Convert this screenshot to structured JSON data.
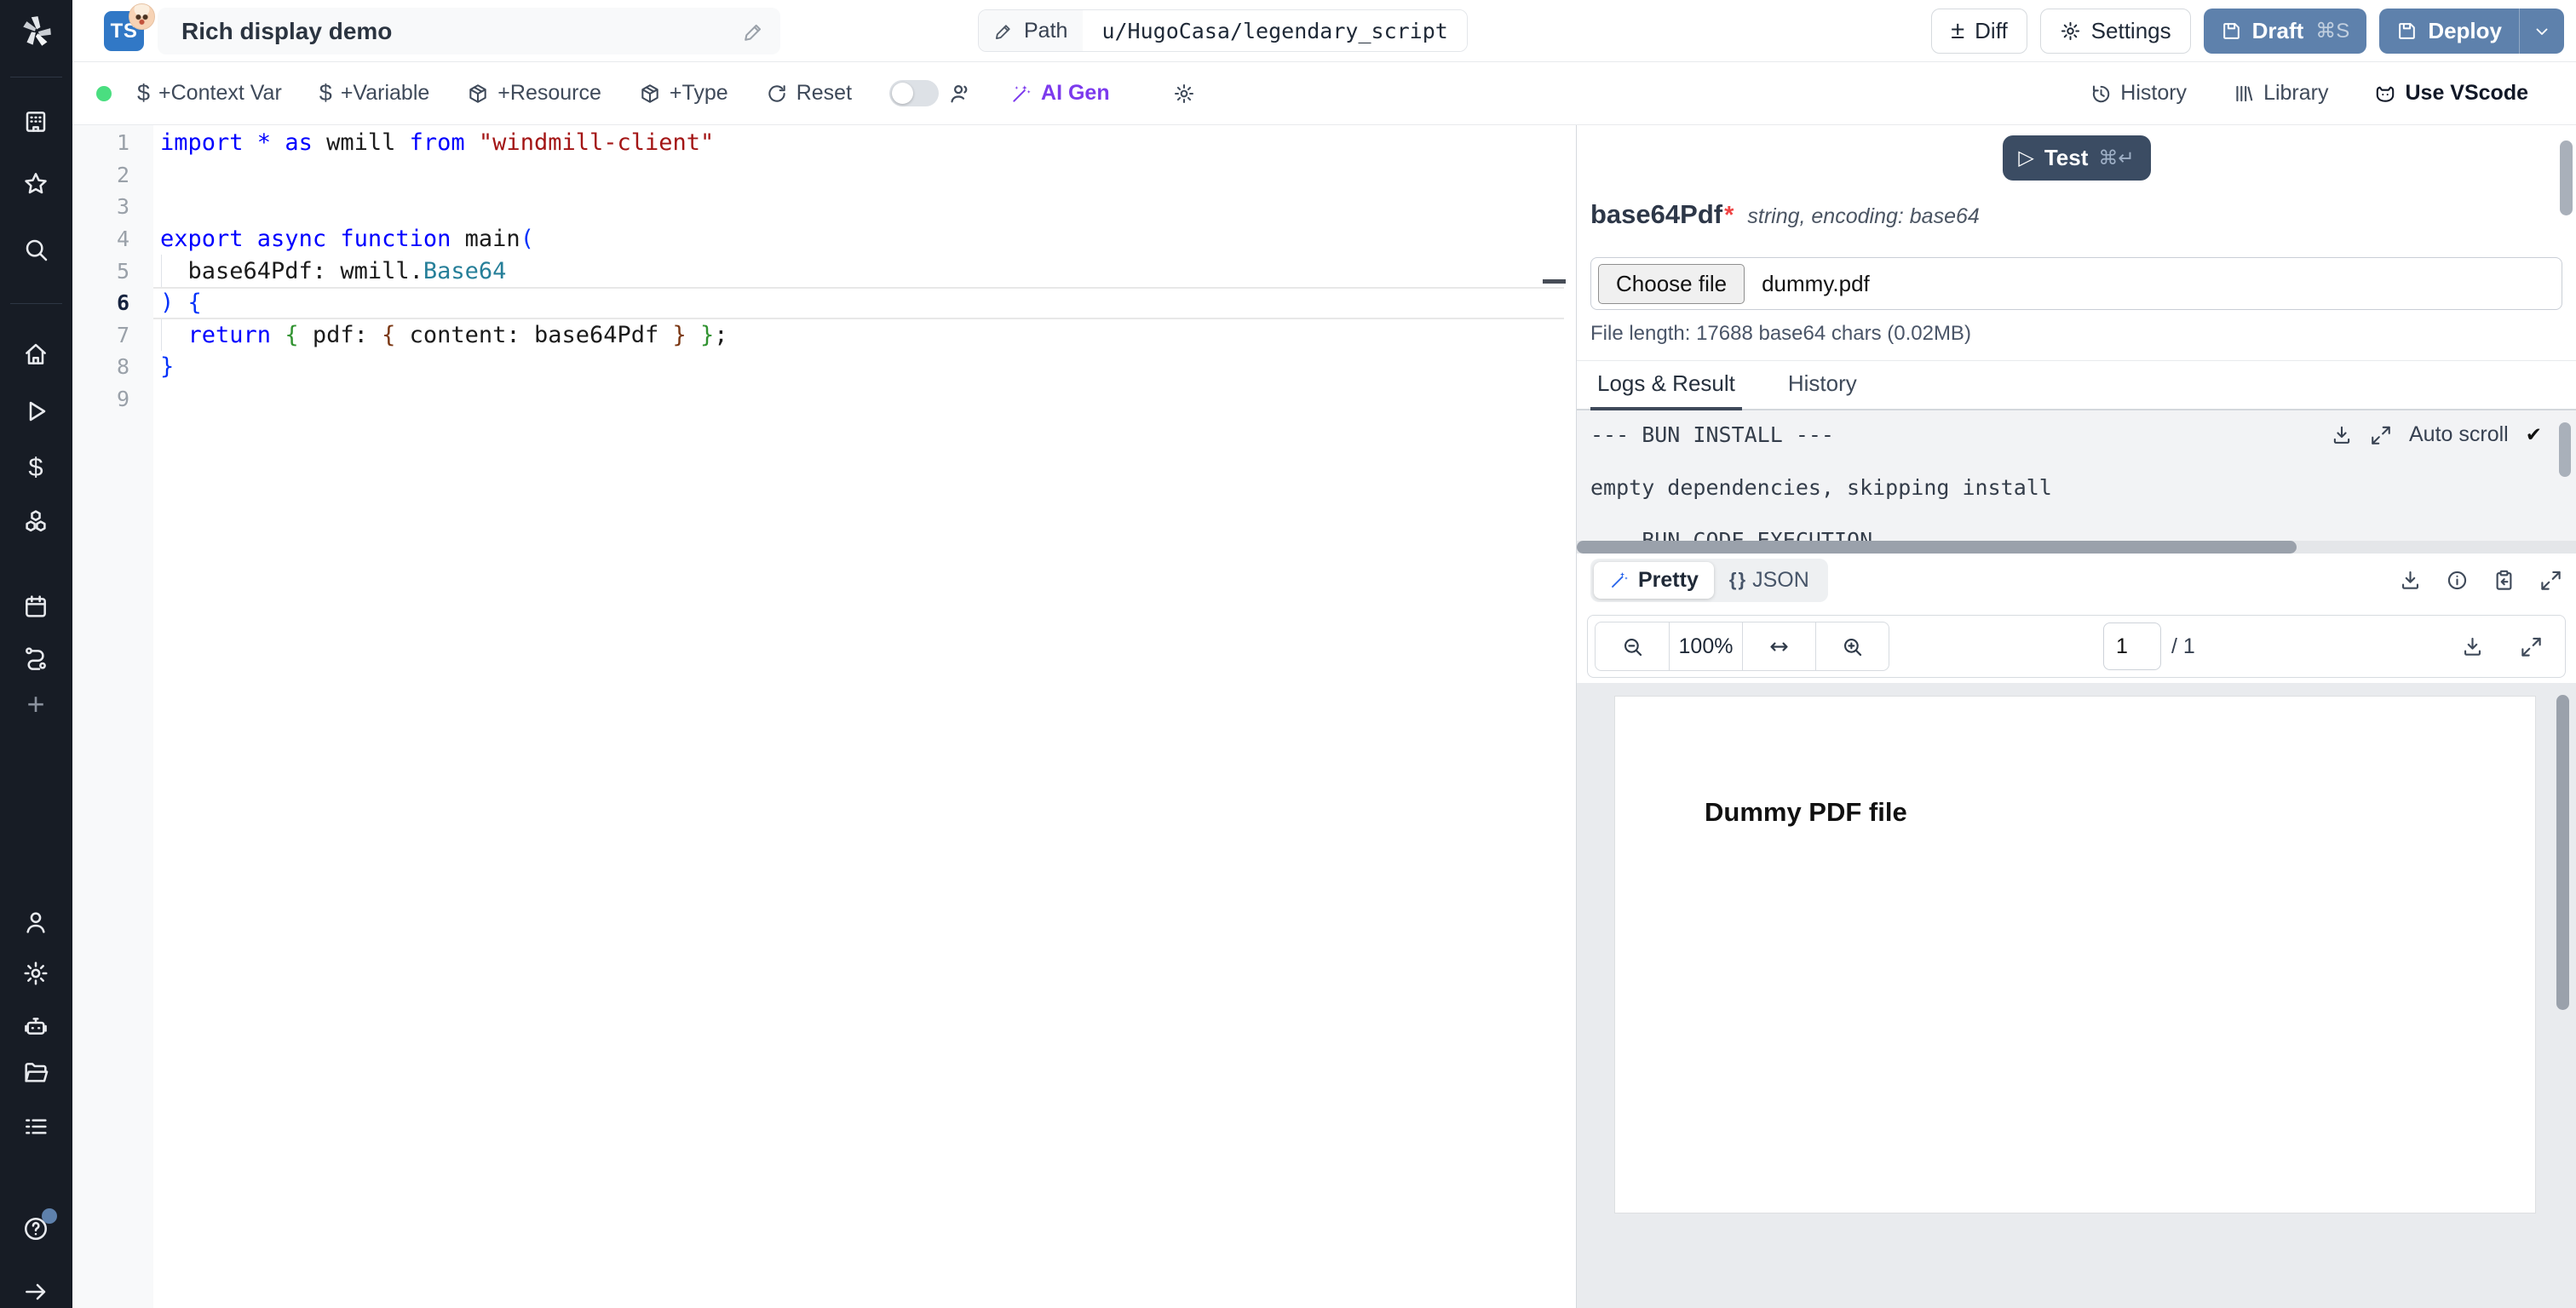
{
  "topbar": {
    "language_badge": "TS",
    "title": "Rich display demo",
    "path_label": "Path",
    "path_value": "u/HugoCasa/legendary_script",
    "diff_label": "Diff",
    "settings_label": "Settings",
    "draft_label": "Draft",
    "draft_shortcut": "⌘S",
    "deploy_label": "Deploy"
  },
  "toolbar": {
    "context_var_label": "+Context Var",
    "variable_label": "+Variable",
    "resource_label": "+Resource",
    "type_label": "+Type",
    "reset_label": "Reset",
    "ai_gen_label": "AI Gen",
    "history_label": "History",
    "library_label": "Library",
    "vscode_label": "Use VScode"
  },
  "editor": {
    "lines": [
      {
        "n": "1",
        "segs": [
          [
            "import ",
            "kw"
          ],
          [
            "* ",
            "kw"
          ],
          [
            "as ",
            "kw"
          ],
          [
            "wmill ",
            "pl"
          ],
          [
            "from ",
            "kw"
          ],
          [
            "\"windmill-client\"",
            "str"
          ]
        ]
      },
      {
        "n": "2",
        "segs": []
      },
      {
        "n": "3",
        "segs": []
      },
      {
        "n": "4",
        "segs": [
          [
            "export ",
            "kw"
          ],
          [
            "async ",
            "kw"
          ],
          [
            "function ",
            "kw"
          ],
          [
            "main",
            "pl"
          ],
          [
            "(",
            "b1"
          ]
        ]
      },
      {
        "n": "5",
        "g": true,
        "segs": [
          [
            "  base64Pdf: wmill.",
            "pl"
          ],
          [
            "Base64",
            "ty"
          ]
        ]
      },
      {
        "n": "6",
        "a": true,
        "segs": [
          [
            ") {",
            "b1"
          ]
        ]
      },
      {
        "n": "7",
        "g": true,
        "segs": [
          [
            "  ",
            "pl"
          ],
          [
            "return ",
            "kw"
          ],
          [
            "{",
            "b2"
          ],
          [
            " pdf: ",
            "pl"
          ],
          [
            "{",
            "b3"
          ],
          [
            " content: base64Pdf ",
            "pl"
          ],
          [
            "}",
            "b3"
          ],
          [
            " ",
            "pl"
          ],
          [
            "}",
            "b2"
          ],
          [
            ";",
            "pl"
          ]
        ]
      },
      {
        "n": "8",
        "segs": [
          [
            "}",
            "b1"
          ]
        ]
      },
      {
        "n": "9",
        "segs": []
      }
    ]
  },
  "run_panel": {
    "test_label": "Test",
    "test_shortcut": "⌘↵",
    "field_name": "base64Pdf",
    "required_mark": "*",
    "field_type": "string, encoding: base64",
    "choose_file_label": "Choose file",
    "file_name": "dummy.pdf",
    "file_info": "File length: 17688 base64 chars (0.02MB)",
    "tab_logs": "Logs & Result",
    "tab_history": "History",
    "autoscroll_label": "Auto scroll",
    "autoscroll_check": "✔",
    "log_lines": [
      "--- BUN INSTALL ---",
      "empty dependencies, skipping install",
      "--- BUN CODE EXECUTION ---"
    ],
    "pretty_label": "Pretty",
    "json_glyph": "{ }",
    "json_label": "JSON",
    "pdf_zoom": "100%",
    "pdf_page": "1",
    "pdf_page_total": "/ 1",
    "pdf_body_text": "Dummy PDF file"
  },
  "colors": {
    "sidebar_bg": "#171c25",
    "primary_button": "#5e81ac",
    "test_button": "#3b4c63",
    "ai_gen": "#7c3aed",
    "status_dot": "#4ade80",
    "ts_badge": "#3178c6",
    "log_bg": "#f2f3f5",
    "pdf_area_bg": "#e9ebee",
    "required_mark": "#ef4444"
  }
}
